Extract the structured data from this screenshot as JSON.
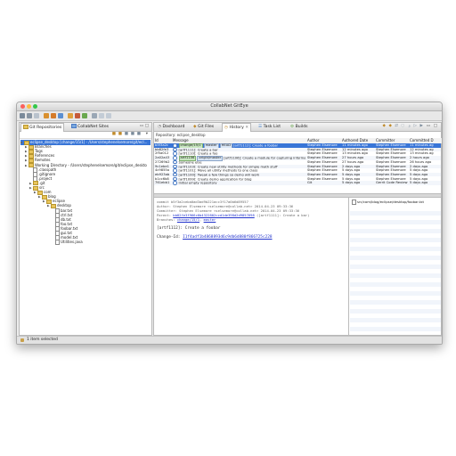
{
  "window": {
    "title": "CollabNet GitEye"
  },
  "left_panel": {
    "tabs": [
      "Git Repositories",
      "CollabNet Sites"
    ],
    "tree": [
      {
        "label": "eclipse_desktop [change/15/1] - /Users/stephenelsemore/git/ecl...",
        "indent": 0,
        "type": "repo",
        "selected": true
      },
      {
        "label": "Branches",
        "indent": 1,
        "type": "folder"
      },
      {
        "label": "Tags",
        "indent": 1,
        "type": "folder"
      },
      {
        "label": "References",
        "indent": 1,
        "type": "folder"
      },
      {
        "label": "Remotes",
        "indent": 1,
        "type": "folder"
      },
      {
        "label": "Working Directory - /Users/stephenelsemore/git/eclipse_deskto",
        "indent": 1,
        "type": "folder"
      },
      {
        "label": ".classpath",
        "indent": 2,
        "type": "file"
      },
      {
        "label": ".gitignore",
        "indent": 2,
        "type": "file"
      },
      {
        "label": ".project",
        "indent": 2,
        "type": "file"
      },
      {
        "label": ".git",
        "indent": 2,
        "type": "folder"
      },
      {
        "label": "src",
        "indent": 2,
        "type": "folder"
      },
      {
        "label": "com",
        "indent": 3,
        "type": "folder"
      },
      {
        "label": "blog",
        "indent": 4,
        "type": "folder"
      },
      {
        "label": "eclipse",
        "indent": 5,
        "type": "folder"
      },
      {
        "label": "desktop",
        "indent": 6,
        "type": "folder"
      },
      {
        "label": "bar.txt",
        "indent": 7,
        "type": "file"
      },
      {
        "label": "ctrl.txt",
        "indent": 7,
        "type": "file"
      },
      {
        "label": "db.txt",
        "indent": 7,
        "type": "file"
      },
      {
        "label": "foo.txt",
        "indent": 7,
        "type": "file"
      },
      {
        "label": "foobar.txt",
        "indent": 7,
        "type": "file"
      },
      {
        "label": "gui.txt",
        "indent": 7,
        "type": "file"
      },
      {
        "label": "model.txt",
        "indent": 7,
        "type": "file"
      },
      {
        "label": "Utilities.java",
        "indent": 7,
        "type": "file"
      }
    ]
  },
  "right_panel": {
    "tabs": [
      "Dashboard",
      "Git Files",
      "History",
      "Task List",
      "Builds"
    ],
    "active_tab": "History",
    "repository_label": "Repository: eclipse_desktop",
    "columns": [
      "Id",
      "Message",
      "Author",
      "Authored Date",
      "Committer",
      "Committed D"
    ],
    "rows": [
      {
        "id": "b5f3a2c",
        "refs": [
          "change/15/1",
          "master",
          "HEAD"
        ],
        "message": "[artf1112]: Create a foobar",
        "author": "Stephen Elsemore",
        "authored": "11 minutes ago",
        "committer": "Stephen Elsemore",
        "committed": "11 minutes ag",
        "selected": true
      },
      {
        "id": "bb82fe3",
        "refs": [],
        "message": "[artf1111]: Create a bar",
        "author": "Stephen Elsemore",
        "authored": "12 minutes ago",
        "committer": "Stephen Elsemore",
        "committed": "12 minutes ag"
      },
      {
        "id": "2f5a012",
        "refs": [],
        "message": "[artf1110]: Create a foo",
        "author": "Stephen Elsemore",
        "authored": "13 minutes ago",
        "committer": "Stephen Elsemore",
        "committed": "13 minutes ag"
      },
      {
        "id": "2a02a43",
        "refs": [
          "artf1106",
          "origin/master"
        ],
        "message": "[artf1106]: Create a module for capturing information",
        "author": "Stephen Elsemore",
        "authored": "27 hours ago",
        "committer": "Stephen Elsemore",
        "committed": "2 hours ago"
      },
      {
        "id": "27269b2",
        "refs": [],
        "message": "Someone else",
        "author": "Stephen Elsemore",
        "authored": "27 hours ago",
        "committer": "Stephen Elsemore",
        "committed": "26 hours ago"
      },
      {
        "id": "9c1ebe1",
        "refs": [],
        "message": "[artf1103]: Create new utility methods for simple math stuff",
        "author": "Stephen Elsemore",
        "authored": "2 days ago",
        "committer": "Stephen Elsemore",
        "committed": "2 days ago"
      },
      {
        "id": "4c9855a",
        "refs": [],
        "message": "[artf1101]: Move all utility methods to one class",
        "author": "Stephen Elsemore",
        "authored": "5 days ago",
        "committer": "Stephen Elsemore",
        "committed": "5 days ago"
      },
      {
        "id": "eb923ab",
        "refs": [],
        "message": "[artf1100]: Tweak a few things so demo will work",
        "author": "Stephen Elsemore",
        "authored": "5 days ago",
        "committer": "Stephen Elsemore",
        "committed": "5 days ago"
      },
      {
        "id": "b1cc6b8",
        "refs": [],
        "message": "[artf1099]: Create demo application for blog",
        "author": "Stephen Elsemore",
        "authored": "5 days ago",
        "committer": "Stephen Elsemore",
        "committed": "5 days ago"
      },
      {
        "id": "761ebb1",
        "refs": [],
        "message": "Initial empty repository",
        "author": "Git",
        "authored": "5 days ago",
        "committer": "Gerrit Code Review",
        "committed": "5 days ago"
      }
    ],
    "details": {
      "commit": "commit b5f3a2ceba0ad3ad9b221acc3f17a0b6d89557",
      "author": "Author: Stephen Elsemore <selsemore@collab.net> 2014-04-23 09:33:36",
      "committer": "Committer: Stephen Elsemore <selsemore@collab.net> 2014-04-23 09:33:36",
      "parent_prefix": "Parent: ",
      "parent_link": "bb82fe3f966c6b4322802ccd1de398d2d9857698",
      "parent_suffix": " ([artf1111]: Create a bar)",
      "branches_prefix": "Branches: ",
      "branch_links": [
        "change/15/1",
        "master"
      ],
      "message": "[artf1112]: Create a foobar",
      "change_prefix": "Change-Id: ",
      "change_link": "I1f4adf1b4868893d6c9db6d880f866725c228"
    },
    "files_panel": {
      "path": "src/com/blog/eclipse/desktop/foobar.txt"
    }
  },
  "status_bar": {
    "text": "1 item selected"
  },
  "colors": {
    "selection": "#3875d7",
    "link": "#2233cc",
    "ref_green": "#c8e6c0"
  }
}
